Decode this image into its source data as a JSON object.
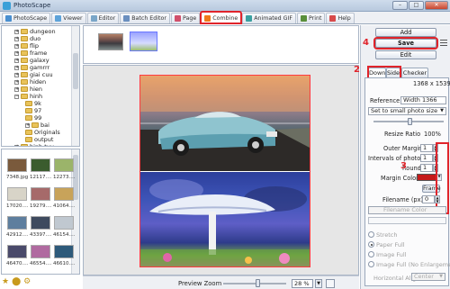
{
  "window": {
    "title": "PhotoScape",
    "min_label": "–",
    "max_label": "□",
    "close_label": "✕"
  },
  "tabs": [
    {
      "label": "PhotoScape",
      "color": "#4a8fd0"
    },
    {
      "label": "Viewer",
      "color": "#5ea3d9"
    },
    {
      "label": "Editor",
      "color": "#7aa6c8"
    },
    {
      "label": "Batch Editor",
      "color": "#6b8fbf"
    },
    {
      "label": "Page",
      "color": "#d1506b"
    },
    {
      "label": "Combine",
      "color": "#f07a1a",
      "active": true
    },
    {
      "label": "Animated GIF",
      "color": "#3aa0a0"
    },
    {
      "label": "Print",
      "color": "#5a8f3a"
    },
    {
      "label": "Help",
      "color": "#d84a4a"
    }
  ],
  "tree": {
    "items": [
      {
        "label": "dungeon",
        "indent": 1,
        "expander": "+"
      },
      {
        "label": "duo",
        "indent": 1,
        "expander": "+"
      },
      {
        "label": "flip",
        "indent": 1,
        "expander": "+"
      },
      {
        "label": "frame",
        "indent": 1,
        "expander": "+"
      },
      {
        "label": "galaxy",
        "indent": 1,
        "expander": "+"
      },
      {
        "label": "gamrrr",
        "indent": 1,
        "expander": "+"
      },
      {
        "label": "giai cuu",
        "indent": 1,
        "expander": "+"
      },
      {
        "label": "hiden",
        "indent": 1,
        "expander": "+"
      },
      {
        "label": "hien",
        "indent": 1,
        "expander": "+"
      },
      {
        "label": "hinh",
        "indent": 1,
        "expander": "−"
      },
      {
        "label": "9k",
        "indent": 2,
        "expander": ""
      },
      {
        "label": "97",
        "indent": 2,
        "expander": ""
      },
      {
        "label": "99",
        "indent": 2,
        "expander": ""
      },
      {
        "label": "bai",
        "indent": 2,
        "expander": "+"
      },
      {
        "label": "Originals",
        "indent": 2,
        "expander": ""
      },
      {
        "label": "output",
        "indent": 2,
        "expander": ""
      },
      {
        "label": "hinh tuy",
        "indent": 1,
        "expander": "+"
      }
    ]
  },
  "thumbnails": [
    {
      "label": "7348.jpg",
      "color": "#7a5a3c"
    },
    {
      "label": "12117....",
      "color": "#3b5c2e"
    },
    {
      "label": "12273....",
      "color": "#9bb46a"
    },
    {
      "label": "17020....",
      "color": "#d8d4c8"
    },
    {
      "label": "19279....",
      "color": "#a66a6a"
    },
    {
      "label": "41064....",
      "color": "#c8a35a"
    },
    {
      "label": "42912....",
      "color": "#5e7e9e"
    },
    {
      "label": "43397....",
      "color": "#3e4a5e"
    },
    {
      "label": "46154....",
      "color": "#c0c8d0"
    },
    {
      "label": "46470....",
      "color": "#4a4a6a"
    },
    {
      "label": "46554....",
      "color": "#b06aa0"
    },
    {
      "label": "46610....",
      "color": "#2e5a7a"
    }
  ],
  "bottom_left_icons": [
    "★",
    "⬤",
    "⚙"
  ],
  "status": {
    "preview_zoom_label": "Preview Zoom",
    "zoom_value": "28 %",
    "zoom_arrow": "▼"
  },
  "panel": {
    "add_label": "Add",
    "save_label": "Save",
    "edit_label": "Edit",
    "badge_2": "2",
    "badge_3": "3",
    "badge_4": "4",
    "tabs": [
      "Down",
      "Side",
      "Checker"
    ],
    "size_value": "1368 x 1539",
    "reference_label": "Reference",
    "reference_value": "Width 1366",
    "size_preset": "Set to small photo size",
    "resize_label": "Resize Ratio",
    "resize_value": "100%",
    "outer_margin_label": "Outer Margin",
    "outer_margin_value": "1",
    "intervals_label": "Intervals of photos",
    "intervals_value": "1",
    "round_label": "Round",
    "round_value": "1",
    "margin_color_label": "Margin Color",
    "margin_color": "#c41a1a",
    "frame_label": "Frame",
    "filename_label": "Filename (px)",
    "filename_value": "0",
    "filename_color_label": "Filename Color",
    "stretch_label": "Stretch",
    "paper_full_label": "Paper Full",
    "image_full_label": "Image Full",
    "image_full_noenl_label": "Image Full (No Enlargement)",
    "h_align_label": "Horizontal Align",
    "h_align_value": "Center"
  }
}
